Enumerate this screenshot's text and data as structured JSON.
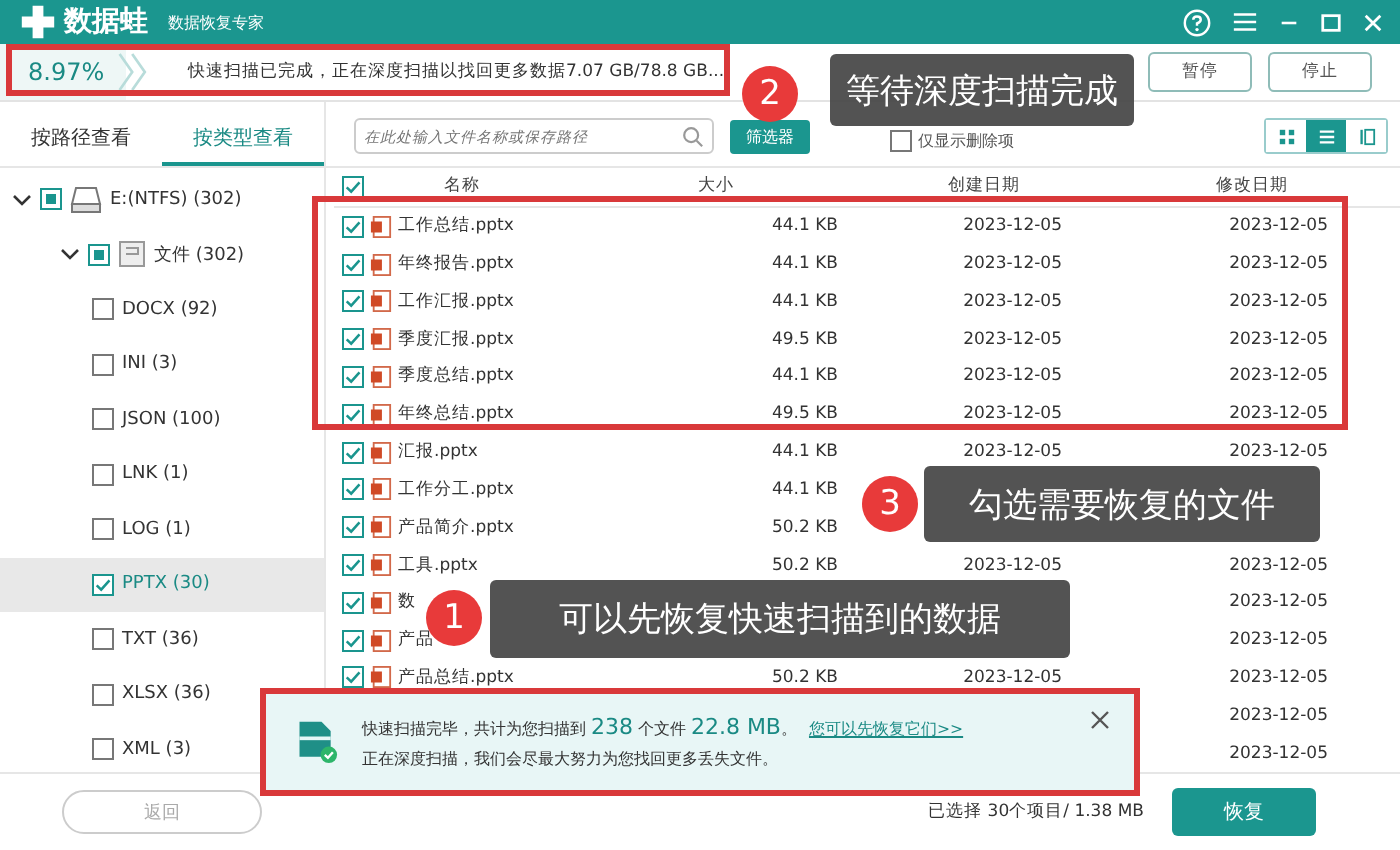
{
  "app": {
    "name": "数据蛙",
    "subtitle": "数据恢复专家"
  },
  "progress": {
    "percent": "8.97%",
    "level": 0.0897,
    "message": "快速扫描已完成，正在深度扫描以找回更多数据7.07 GB/78.8 GB...",
    "buttons": [
      "暂停",
      "停止"
    ]
  },
  "tabs": [
    {
      "label": "按路径查看",
      "selected": false
    },
    {
      "label": "按类型查看",
      "selected": true
    }
  ],
  "search": {
    "placeholder": "在此处输入文件名称或保存路径"
  },
  "filter_button": "筛选器",
  "deleted_only": {
    "label": "仅显示删除项",
    "checked": false
  },
  "view_modes": [
    {
      "kind": "grid",
      "selected": false
    },
    {
      "kind": "list",
      "selected": true
    },
    {
      "kind": "detail",
      "selected": false
    }
  ],
  "tree": [
    {
      "label": "E:(NTFS) (302)",
      "kind": "drive",
      "checked": true,
      "partial": true,
      "selected": false,
      "expanded": true,
      "children": [
        {
          "label": "文件 (302)",
          "kind": "folder",
          "checked": true,
          "partial": true,
          "selected": false,
          "expanded": true,
          "children": [
            {
              "label": "DOCX (92)",
              "checked": false,
              "selected": false
            },
            {
              "label": "INI (3)",
              "checked": false,
              "selected": false
            },
            {
              "label": "JSON (100)",
              "checked": false,
              "selected": false
            },
            {
              "label": "LNK (1)",
              "checked": false,
              "selected": false
            },
            {
              "label": "LOG (1)",
              "checked": false,
              "selected": false
            },
            {
              "label": "PPTX (30)",
              "checked": true,
              "selected": true
            },
            {
              "label": "TXT (36)",
              "checked": false,
              "selected": false
            },
            {
              "label": "XLSX (36)",
              "checked": false,
              "selected": false
            },
            {
              "label": "XML (3)",
              "checked": false,
              "selected": false
            }
          ]
        }
      ]
    }
  ],
  "back_button": {
    "label": "返回",
    "disabled": true
  },
  "table": {
    "all_checked": true,
    "columns": [
      "名称",
      "大小",
      "创建日期",
      "修改日期"
    ],
    "rows": [
      {
        "checked": true,
        "name": "工作总结.pptx",
        "size": "44.1 KB",
        "created": "2023-12-05",
        "modified": "2023-12-05"
      },
      {
        "checked": true,
        "name": "年终报告.pptx",
        "size": "44.1 KB",
        "created": "2023-12-05",
        "modified": "2023-12-05"
      },
      {
        "checked": true,
        "name": "工作汇报.pptx",
        "size": "44.1 KB",
        "created": "2023-12-05",
        "modified": "2023-12-05"
      },
      {
        "checked": true,
        "name": "季度汇报.pptx",
        "size": "49.5 KB",
        "created": "2023-12-05",
        "modified": "2023-12-05"
      },
      {
        "checked": true,
        "name": "季度总结.pptx",
        "size": "44.1 KB",
        "created": "2023-12-05",
        "modified": "2023-12-05"
      },
      {
        "checked": true,
        "name": "年终总结.pptx",
        "size": "49.5 KB",
        "created": "2023-12-05",
        "modified": "2023-12-05"
      },
      {
        "checked": true,
        "name": "汇报.pptx",
        "size": "44.1 KB",
        "created": "2023-12-05",
        "modified": "2023-12-05"
      },
      {
        "checked": true,
        "name": "工作分工.pptx",
        "size": "44.1 KB"
      },
      {
        "checked": true,
        "name": "产品简介.pptx",
        "size": "50.2 KB"
      },
      {
        "checked": true,
        "name": "工具.pptx",
        "size": "50.2 KB",
        "created": "2023-12-05",
        "modified": "2023-12-05"
      },
      {
        "checked": true,
        "name": "数",
        "modified": "2023-12-05"
      },
      {
        "checked": true,
        "name": "产品",
        "modified": "2023-12-05"
      },
      {
        "checked": true,
        "name": "产品总结.pptx",
        "size": "50.2 KB",
        "created": "2023-12-05",
        "modified": "2023-12-05"
      },
      {
        "modified": "2023-12-05"
      },
      {
        "modified": "2023-12-05"
      }
    ]
  },
  "banner": {
    "prefix": "快速扫描完毕，共计为您扫描到",
    "file_count": "238",
    "count_unit": "个文件",
    "total_size": "22.8 MB",
    "end": "。",
    "link": "您可以先恢复它们>>",
    "detail": "正在深度扫描，我们会尽最大努力为您找回更多丢失文件。"
  },
  "selection_info": "已选择 30个项目/ 1.38 MB",
  "recover_button": "恢复",
  "annotations": [
    {
      "number": "2",
      "text": "等待深度扫描完成"
    },
    {
      "number": "3",
      "text": "勾选需要恢复的文件"
    },
    {
      "number": "1",
      "text": "可以先恢复快速扫描到的数据"
    }
  ]
}
